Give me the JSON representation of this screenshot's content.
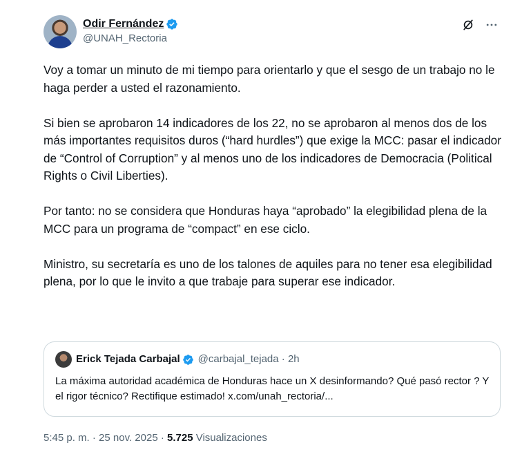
{
  "author": {
    "display_name": "Odir Fernández",
    "handle": "@UNAH_Rectoria",
    "verified": true
  },
  "icons": {
    "grok": "grok-icon",
    "more": "more-icon",
    "verified": "verified-badge-icon"
  },
  "accent_color": "#1d9bf0",
  "tweet": {
    "paragraphs": [
      "Voy a tomar un minuto de mi tiempo para orientarlo y que el sesgo de un trabajo no le haga perder a usted el razonamiento.",
      "Si bien se aprobaron 14 indicadores de los 22, no se aprobaron al menos dos de los más importantes  requisitos duros (“hard hurdles”) que exige la MCC: pasar el indicador de “Control of Corruption” y al menos uno de los indicadores de Democracia (Political Rights o Civil Liberties).",
      "Por tanto: no se considera que Honduras haya “aprobado” la elegibilidad plena de la MCC para un programa de “compact” en ese ciclo.",
      "Ministro, su secretaría es uno de los talones de aquiles para no tener esa elegibilidad plena, por lo que le invito a que trabaje para superar ese indicador."
    ]
  },
  "quote": {
    "display_name": "Erick Tejada Carbajal",
    "handle_time": "@carbajal_tejada · 2h",
    "text": "La máxima autoridad académica de Honduras hace un X  desinformando? Qué pasó rector ? Y el rigor técnico? Rectifique estimado! x.com/unah_rectoria/..."
  },
  "meta": {
    "timestamp": "5:45 p. m. · 25 nov. 2025 · ",
    "views_count": "5.725",
    "views_label": " Visualizaciones"
  }
}
